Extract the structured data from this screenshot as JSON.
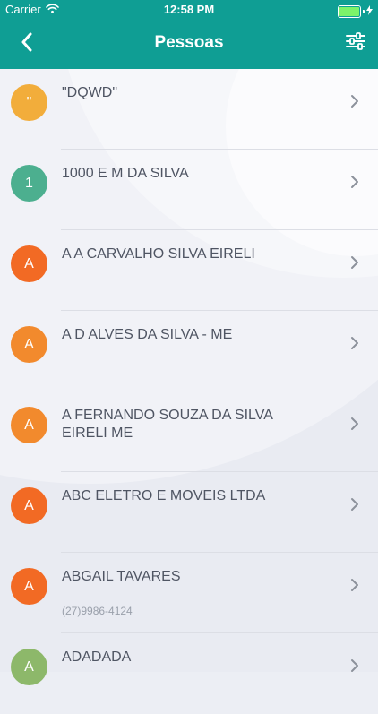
{
  "status_bar": {
    "carrier": "Carrier",
    "time": "12:58 PM"
  },
  "header": {
    "title": "Pessoas",
    "background_color": "#0f9e94"
  },
  "icons": {
    "back": "chevron-left-icon",
    "filter": "sliders-icon",
    "row": "chevron-right-icon",
    "wifi": "wifi-icon",
    "battery": "battery-icon",
    "charging": "charging-bolt-icon"
  },
  "people": [
    {
      "initial": "\"",
      "name": "\"DQWD\"",
      "phone": "",
      "color": "#f2ad3b"
    },
    {
      "initial": "1",
      "name": "1000 E M DA SILVA",
      "phone": "",
      "color": "#4caf8f"
    },
    {
      "initial": "A",
      "name": "A A CARVALHO SILVA EIRELI",
      "phone": "",
      "color": "#f26a24"
    },
    {
      "initial": "A",
      "name": "A D ALVES DA SILVA - ME",
      "phone": "",
      "color": "#f28a2d"
    },
    {
      "initial": "A",
      "name": "A FERNANDO SOUZA DA SILVA EIRELI ME",
      "phone": "",
      "color": "#f28a2d"
    },
    {
      "initial": "A",
      "name": "ABC ELETRO E MOVEIS LTDA",
      "phone": "",
      "color": "#f26a24"
    },
    {
      "initial": "A",
      "name": "ABGAIL TAVARES",
      "phone": "(27)9986-4124",
      "color": "#f26a24"
    },
    {
      "initial": "A",
      "name": "ADADADA",
      "phone": "",
      "color": "#8db86a"
    }
  ]
}
